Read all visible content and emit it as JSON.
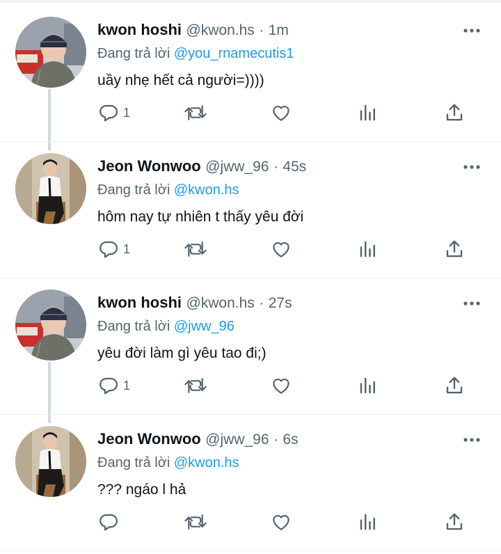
{
  "reply_prefix": "Đang trả lời",
  "tweets": [
    {
      "name": "kwon hoshi",
      "handle": "@kwon.hs",
      "sep": "·",
      "time": "1m",
      "reply_to": "@you_rnamecutis1",
      "text": "uầy nhẹ hết cả người=))))",
      "reply_count": "1"
    },
    {
      "name": "Jeon Wonwoo",
      "handle": "@jww_96",
      "sep": "·",
      "time": "45s",
      "reply_to": "@kwon.hs",
      "text": "hôm nay tự nhiên t thấy yêu đời",
      "reply_count": "1"
    },
    {
      "name": "kwon hoshi",
      "handle": "@kwon.hs",
      "sep": "·",
      "time": "27s",
      "reply_to": "@jww_96",
      "text": "yêu đời làm gì yêu tao đi;)",
      "reply_count": "1"
    },
    {
      "name": "Jeon Wonwoo",
      "handle": "@jww_96",
      "sep": "·",
      "time": "6s",
      "reply_to": "@kwon.hs",
      "text": "??? ngáo l hả",
      "reply_count": ""
    }
  ],
  "colors": {
    "accent": "#1d9bf0",
    "text": "#0f1419",
    "muted": "#536471",
    "thread": "#cfd9de"
  },
  "icons": [
    "reply-icon",
    "retweet-icon",
    "like-icon",
    "views-icon",
    "share-icon",
    "more-icon"
  ]
}
